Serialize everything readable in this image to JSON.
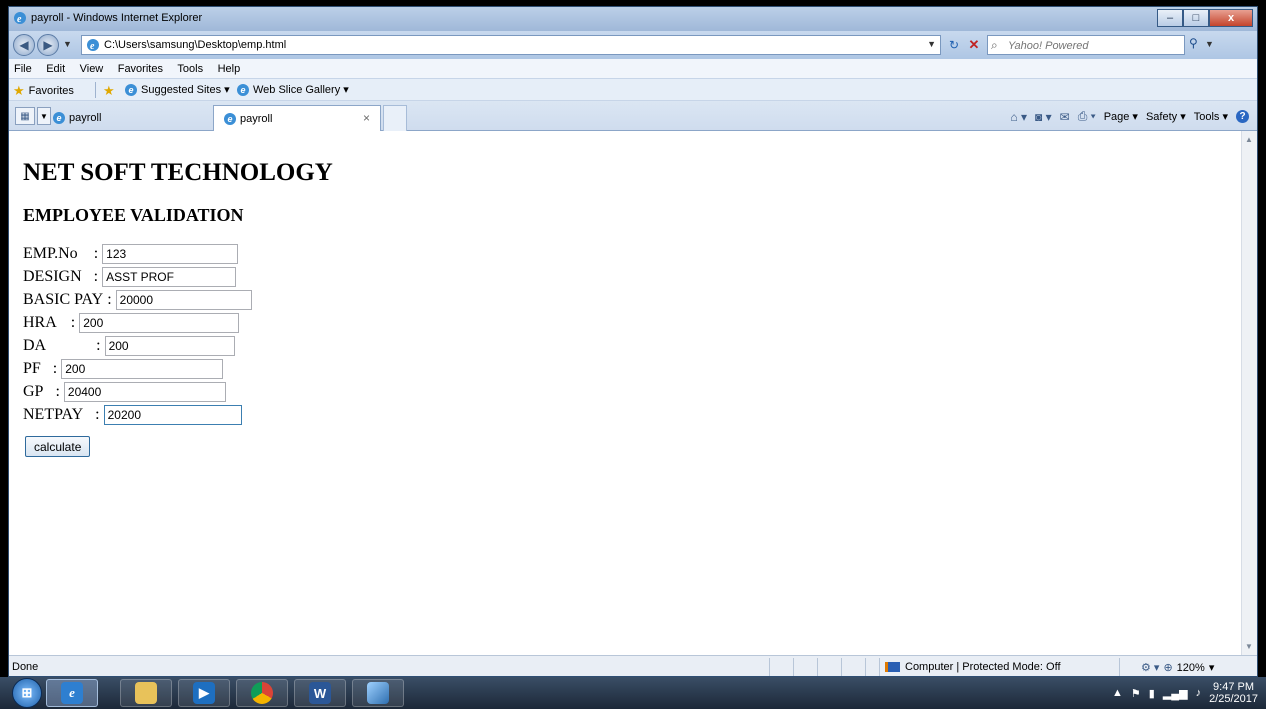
{
  "window": {
    "title": "payroll - Windows Internet Explorer",
    "minimize": "–",
    "maximize": "□",
    "close": "x"
  },
  "address_bar": {
    "url": "C:\\Users\\samsung\\Desktop\\emp.html",
    "search_placeholder": "Yahoo! Powered"
  },
  "menu": [
    "File",
    "Edit",
    "View",
    "Favorites",
    "Tools",
    "Help"
  ],
  "favorites_bar": {
    "favorites_label": "Favorites",
    "suggested_sites": "Suggested Sites ▾",
    "web_slice_gallery": "Web Slice Gallery ▾"
  },
  "tabs": [
    {
      "label": "payroll"
    },
    {
      "label": "payroll",
      "close": "×",
      "active": true
    }
  ],
  "command_bar": {
    "page": "Page ▾",
    "safety": "Safety ▾",
    "tools": "Tools ▾",
    "help": "?"
  },
  "page": {
    "heading": "NET SOFT TECHNOLOGY",
    "subheading": "EMPLOYEE VALIDATION",
    "fields": [
      {
        "label": "EMP.No",
        "value": "123"
      },
      {
        "label": "DESIGN",
        "value": "ASST PROF"
      },
      {
        "label": "BASIC PAY",
        "value": "20000"
      },
      {
        "label": "HRA",
        "value": "200"
      },
      {
        "label": "DA",
        "value": "200"
      },
      {
        "label": "PF",
        "value": "200"
      },
      {
        "label": "GP",
        "value": "20400"
      },
      {
        "label": "NETPAY",
        "value": "20200"
      }
    ],
    "colon": ":",
    "button_label": "calculate"
  },
  "status_bar": {
    "status": "Done",
    "zone": "Computer | Protected Mode: Off",
    "zoom": "120%"
  },
  "taskbar": {
    "time": "9:47 PM",
    "date": "2/25/2017"
  },
  "colors": {
    "chrome": "#dbe6f3",
    "taskbar": "#1c2838",
    "button_border": "#2f6a9c"
  }
}
